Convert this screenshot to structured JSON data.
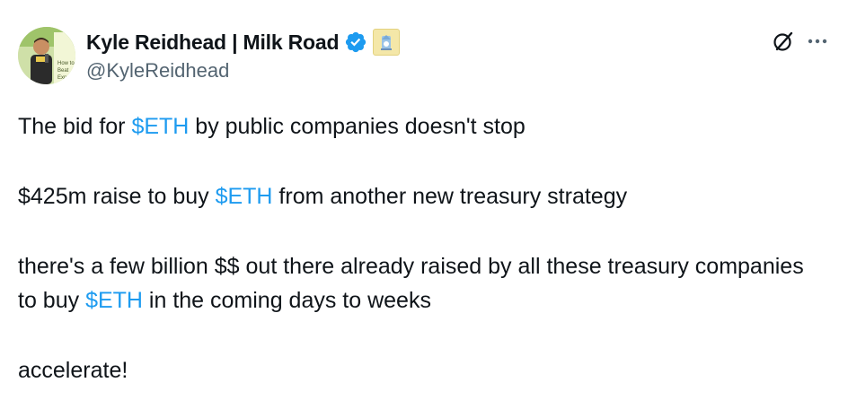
{
  "author": {
    "display_name": "Kyle Reidhead | Milk Road",
    "handle": "@KyleReidhead",
    "verified_icon": "verified-badge-icon",
    "affiliate_badge_icon": "milk-road-badge-icon",
    "avatar_sign_text": [
      "How to",
      "Beat",
      "Exp"
    ]
  },
  "actions": {
    "grok_icon": "grok-icon",
    "more_icon": "more-options-icon"
  },
  "tweet": {
    "line1_a": "The bid for ",
    "line1_tag": "$ETH",
    "line1_b": " by public companies doesn't stop",
    "line2_a": "$425m raise to buy ",
    "line2_tag": "$ETH",
    "line2_b": " from another new treasury strategy",
    "line3_a": "there's a few billion $$ out there already raised by all these treasury companies to buy ",
    "line3_tag": "$ETH",
    "line3_b": " in the coming days to weeks",
    "line4": "accelerate!"
  },
  "colors": {
    "text": "#0f1419",
    "secondary": "#536471",
    "link": "#1d9bf0"
  }
}
